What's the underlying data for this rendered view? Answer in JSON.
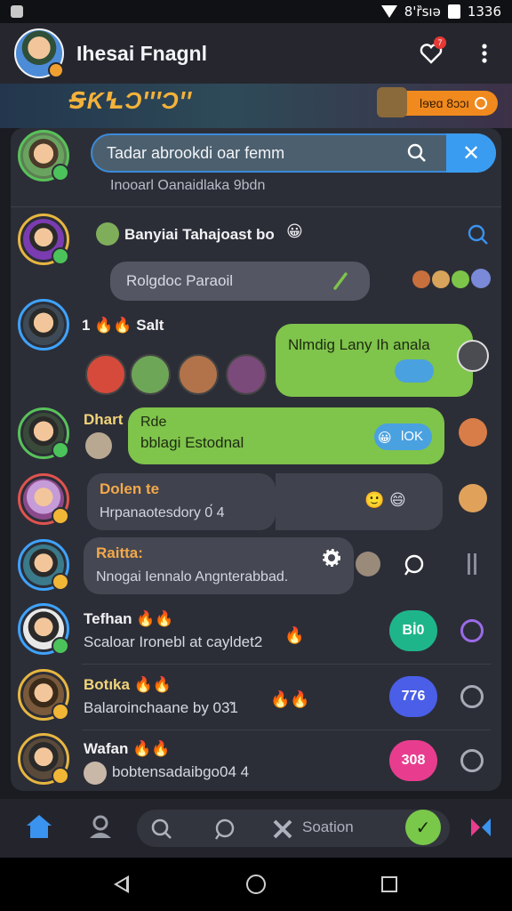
{
  "statusbar": {
    "time": "1336",
    "signal_text": "8'ȑsıə"
  },
  "appbar": {
    "title": "Ihesai Fnagnl",
    "notification_count": "7"
  },
  "banner": {
    "logo_text": "ꞨƘꝆƆꞌꞌꞌƆꞌꞌ",
    "pill_text": "Ɩɘɐɑ 8ɔɔı"
  },
  "search": {
    "value": "Tadar abrookdi oar femm",
    "subtitle": "Inooarl Oanaidlaka 9bdn"
  },
  "rows": [
    {
      "name": "Banyiai Tahajoast bo",
      "message": "Rolgdoc Paraoil"
    },
    {
      "name": "1",
      "name_suffix": "Salt",
      "message": "Nlmdig Lany Ih anala"
    },
    {
      "name": "Dhart",
      "message_title": "Rde",
      "message": "bblagi Estodnal",
      "tag": "lOK"
    },
    {
      "name": "Dolen te",
      "message": "Hrpanaotesdory 0́ 4"
    },
    {
      "name": "Raitta:",
      "message": "Nnogai Iennalo Angnterabbad."
    },
    {
      "name": "Tefhan",
      "message": "Scaloar Ironebl at cayldet2",
      "count": "Bİ0"
    },
    {
      "name": "Botıka",
      "message": "Balaroinchaane by 03̃1",
      "count": "776"
    },
    {
      "name": "Wafan",
      "message": "bobtensadaibgo04 4",
      "count": "308"
    }
  ],
  "nav": {
    "search_label": "Soation"
  },
  "colors": {
    "accent": "#3a93ef",
    "green": "#7fc44b",
    "teal": "#1fb58a",
    "blue": "#4a5ee8",
    "pink": "#e83d8f"
  },
  "icons": [
    "home-icon",
    "contacts-icon",
    "search-icon",
    "chat-icon",
    "tools-icon",
    "add-icon",
    "share-icon"
  ]
}
